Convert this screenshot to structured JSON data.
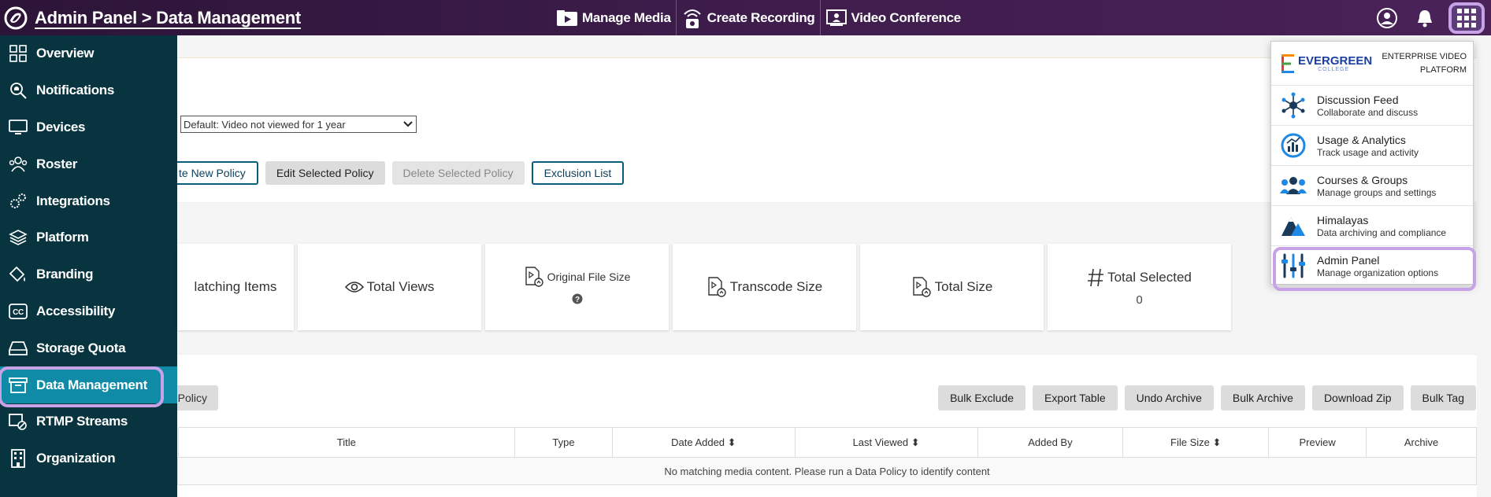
{
  "header": {
    "breadcrumb": "Admin Panel > Data Management",
    "nav": [
      {
        "label": "Manage Media",
        "icon": "play-folder-icon"
      },
      {
        "label": "Create Recording",
        "icon": "recording-icon"
      },
      {
        "label": "Video Conference",
        "icon": "video-conference-icon"
      }
    ]
  },
  "sidebar": {
    "items": [
      {
        "label": "Overview",
        "icon": "grid-icon"
      },
      {
        "label": "Notifications",
        "icon": "search-bell-icon"
      },
      {
        "label": "Devices",
        "icon": "monitor-icon"
      },
      {
        "label": "Roster",
        "icon": "people-icon"
      },
      {
        "label": "Integrations",
        "icon": "gears-icon"
      },
      {
        "label": "Platform",
        "icon": "layers-icon"
      },
      {
        "label": "Branding",
        "icon": "paint-bucket-icon"
      },
      {
        "label": "Accessibility",
        "icon": "cc-icon"
      },
      {
        "label": "Storage Quota",
        "icon": "drive-icon"
      },
      {
        "label": "Data Management",
        "icon": "archive-box-icon"
      },
      {
        "label": "RTMP Streams",
        "icon": "stream-icon"
      },
      {
        "label": "Organization",
        "icon": "building-icon"
      }
    ],
    "active_index": 9
  },
  "policy": {
    "select_value": "Default: Video not viewed for 1 year",
    "buttons": {
      "create": "te New Policy",
      "edit": "Edit Selected Policy",
      "delete": "Delete Selected Policy",
      "exclusion": "Exclusion List"
    }
  },
  "stats": [
    {
      "label": "latching Items",
      "value": ""
    },
    {
      "label": "Total Views",
      "value": ""
    },
    {
      "label": "Original File Size",
      "value": "?"
    },
    {
      "label": "Transcode Size",
      "value": ""
    },
    {
      "label": "Total Size",
      "value": ""
    },
    {
      "label": "Total Selected",
      "value": "0"
    }
  ],
  "table_actions": {
    "policy_btn": "Policy",
    "buttons": [
      "Bulk Exclude",
      "Export Table",
      "Undo Archive",
      "Bulk Archive",
      "Download Zip",
      "Bulk Tag"
    ]
  },
  "table": {
    "columns": [
      "",
      "Title",
      "Type",
      "Date Added ⬍",
      "Last Viewed ⬍",
      "Added By",
      "File Size ⬍",
      "Preview",
      "Archive"
    ],
    "empty_message": "No matching media content. Please run a Data Policy to identify content"
  },
  "apps_menu": {
    "brand": "EVERGREEN",
    "brand_sub": "COLLEGE",
    "platform_line1": "ENTERPRISE VIDEO",
    "platform_line2": "PLATFORM",
    "items": [
      {
        "name": "Discussion Feed",
        "desc": "Collaborate and discuss"
      },
      {
        "name": "Usage & Analytics",
        "desc": "Track usage and activity"
      },
      {
        "name": "Courses & Groups",
        "desc": "Manage groups and settings"
      },
      {
        "name": "Himalayas",
        "desc": "Data archiving and compliance"
      },
      {
        "name": "Admin Panel",
        "desc": "Manage organization options"
      }
    ]
  },
  "colors": {
    "topbar": "#3c1c4a",
    "sidebar": "#08343f",
    "active": "#0f8ba8",
    "highlight": "#c8a2e6"
  }
}
